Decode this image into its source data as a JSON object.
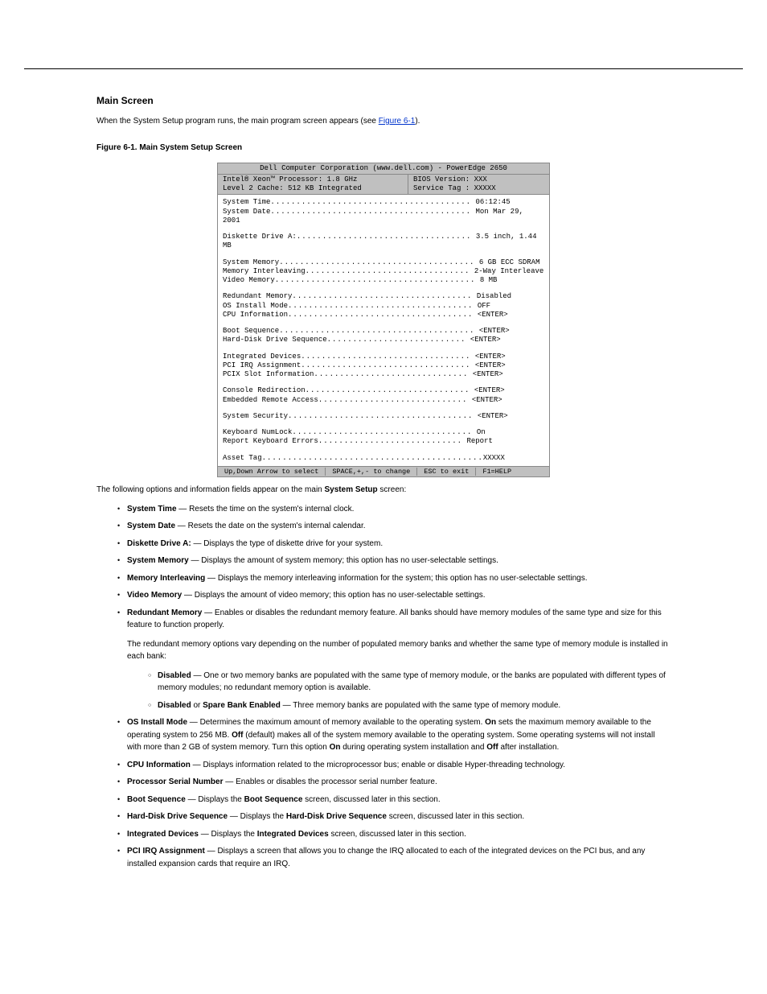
{
  "sections": {
    "main_screen": {
      "heading": "Main Screen",
      "intro": "When the System Setup program runs, the main program screen appears (see ",
      "figure_ref": "Figure 6-1",
      "intro2": ").",
      "fig_label": "Figure 6-1. Main System Setup Screen "
    },
    "bios": {
      "title": "Dell Computer Corporation (www.dell.com) - PowerEdge 2650",
      "info_left1": "Intel® Xeon™ Processor: 1.8 GHz",
      "info_left2": "Level 2 Cache:  512 KB Integrated",
      "info_right1": "BIOS Version: XXX",
      "info_right2": "Service Tag : XXXXX",
      "rows": [
        {
          "label": "System Time ",
          "dots": ".......................................",
          "value": " 06:12:45"
        },
        {
          "label": "System Date ",
          "dots": ".......................................",
          "value": " Mon Mar 29, 2001"
        },
        "gap",
        {
          "label": "Diskette Drive A: ",
          "dots": "..................................",
          "value": " 3.5 inch, 1.44 MB"
        },
        "gap",
        {
          "label": "System Memory ",
          "dots": "......................................",
          "value": " 6 GB ECC SDRAM"
        },
        {
          "label": "Memory Interleaving ",
          "dots": "................................",
          "value": " 2-Way Interleave"
        },
        {
          "label": "Video Memory ",
          "dots": ".......................................",
          "value": " 8 MB"
        },
        "gap",
        {
          "label": "Redundant Memory ",
          "dots": "...................................",
          "value": " Disabled"
        },
        {
          "label": "OS Install Mode ",
          "dots": "....................................",
          "value": " OFF"
        },
        {
          "label": "CPU Information ",
          "dots": "....................................",
          "value": " <ENTER>"
        },
        "gap",
        {
          "label": "Boot Sequence ",
          "dots": "......................................",
          "value": " <ENTER>"
        },
        {
          "label": "Hard-Disk Drive Sequence ",
          "dots": "...........................",
          "value": " <ENTER>"
        },
        "gap",
        {
          "label": "Integrated Devices ",
          "dots": ".................................",
          "value": " <ENTER>"
        },
        {
          "label": "PCI IRQ Assignment ",
          "dots": ".................................",
          "value": " <ENTER>"
        },
        {
          "label": "PCIX Slot Information ",
          "dots": "..............................",
          "value": " <ENTER>"
        },
        "gap",
        {
          "label": "Console Redirection ",
          "dots": "................................",
          "value": " <ENTER>"
        },
        {
          "label": "Embedded Remote Access ",
          "dots": ".............................",
          "value": " <ENTER>"
        },
        "gap",
        {
          "label": "System Security ",
          "dots": "....................................",
          "value": " <ENTER>"
        },
        "gap",
        {
          "label": "Keyboard NumLock ",
          "dots": "...................................",
          "value": " On"
        },
        {
          "label": "Report Keyboard Errors ",
          "dots": "............................",
          "value": " Report"
        },
        "gap",
        {
          "label": "Asset Tag ",
          "dots": "...........................................",
          "value": "XXXXX"
        }
      ],
      "footer": {
        "a": "Up,Down Arrow to select",
        "b": "SPACE,+,- to change",
        "c": "ESC to exit",
        "d": "F1=HELP"
      }
    },
    "options_intro": "The following options and information fields appear on the main ",
    "options_intro_bold": "System Setup",
    "options_intro2": " screen:",
    "opts": [
      {
        "name": "System Time",
        "desc": " Resets the time on the system's internal clock."
      },
      {
        "name": "System Date",
        "desc": " Resets the date on the system's internal calendar."
      },
      {
        "name": "Diskette Drive A:",
        "desc": " Displays the type of diskette drive for your system."
      },
      {
        "name": "System Memory",
        "desc": " Displays the amount of system memory; this option has no user-selectable settings."
      },
      {
        "name": "Memory Interleaving",
        "desc": " Displays the memory interleaving information for the system; this option has no user-selectable settings."
      },
      {
        "name": "Video Memory",
        "desc": " Displays the amount of video memory; this option has no user-selectable settings."
      },
      {
        "name": "Redundant Memory",
        "desc": " Enables or disables the redundant memory feature. All banks should have memory modules of the same type and size for this feature to function properly."
      }
    ],
    "redundant_intro": "The redundant memory options vary depending on the number of populated memory banks and whether the same type of memory module is installed in each bank:",
    "redundant_sub": [
      {
        "name": "Disabled",
        "desc": " One or two memory banks are populated with the same type of memory module, or the banks are populated with different types of memory modules; no redundant memory option is available."
      },
      {
        "name": "Disabled",
        "or": "Spare Bank Enabled",
        "desc": " Three memory banks are populated with the same type of memory module."
      }
    ],
    "opts2pre": {
      "name": "OS Install Mode",
      "desc": " Determines the maximum amount of memory available to the operating system. ",
      "opt_on": "On",
      "on_desc": " sets the maximum memory available to the operating system to 256 MB. ",
      "opt_off": "Off",
      "off_desc": " (default) makes all of the system memory available to the operating system. Some operating systems will not install with more than 2 GB of system memory. Turn this option ",
      "opt_on2": "On",
      "on_desc2": " during operating system installation and ",
      "opt_off2": "Off",
      "off_desc2": " after installation."
    },
    "opts2": [
      {
        "name": "CPU Information",
        "desc": " Displays information related to the microprocessor bus; enable or disable Hyper-threading technology."
      },
      {
        "name": "Processor Serial Number",
        "desc": " Enables or disables the processor serial number feature."
      },
      {
        "name": "Boot Sequence",
        "desc_pre": " Displays the ",
        "link": "Boot Sequence",
        "desc_post": " screen, discussed later in this section."
      },
      {
        "name": "Hard-Disk Drive Sequence",
        "desc_pre": " Displays the ",
        "link": "Hard-Disk Drive Sequence",
        "desc_post": " screen, discussed later in this section."
      },
      {
        "name": "Integrated Devices",
        "desc_pre": " Displays the ",
        "link": "Integrated Devices",
        "desc_post": " screen, discussed later in this section."
      },
      {
        "name": "PCI IRQ Assignment",
        "desc": " Displays a screen that allows you to change the IRQ allocated to each of the integrated devices on the PCI bus, and any installed expansion cards that require an IRQ."
      }
    ]
  }
}
